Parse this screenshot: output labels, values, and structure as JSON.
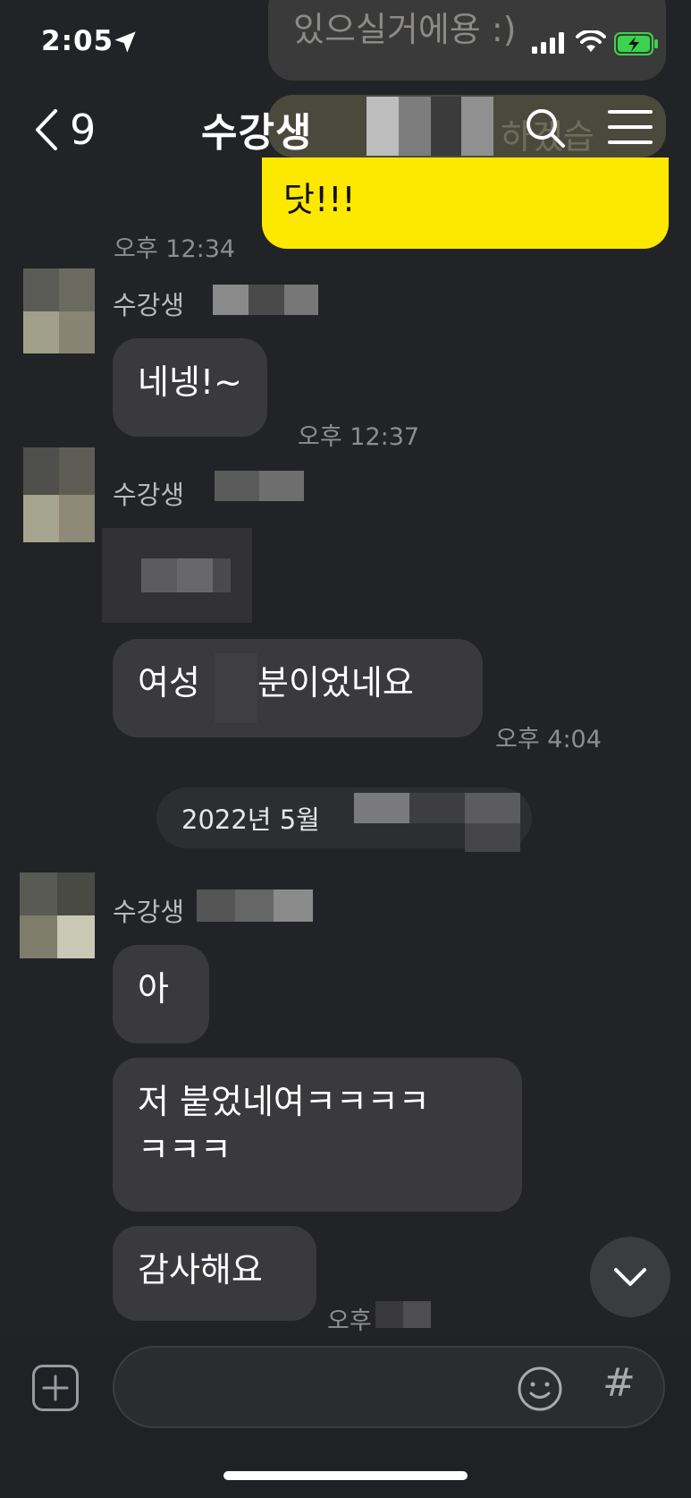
{
  "status_bar": {
    "time": "2:05"
  },
  "header": {
    "back_count": "9",
    "title": "수강생"
  },
  "messages": {
    "top_partial_text": "있으실거에용 :)",
    "top_partial_text2": "하겠습",
    "mine_text": "닷!!!",
    "mine_time": "오후 12:34",
    "sender1": "수강생",
    "msg1": "네넹!~",
    "time1": "오후 12:37",
    "sender2": "수강생",
    "msg2_visible_left": "여성",
    "msg2_visible_right": "분이었네요",
    "time2": "오후 4:04",
    "date_chip": "2022년 5월",
    "sender3": "수강생",
    "msg3": "아",
    "msg4_line1": "저 붙었네여ㅋㅋㅋㅋ",
    "msg4_line2": "ㅋㅋㅋ",
    "msg5": "감사해요",
    "time5": "오후"
  },
  "input": {
    "placeholder": "",
    "hash_label": "#"
  },
  "icons": {
    "back": "chevron-left-icon",
    "search": "search-icon",
    "menu": "hamburger-menu-icon",
    "scroll_down": "chevron-down-icon",
    "add": "plus-box-icon",
    "emoji": "emoji-icon",
    "location": "location-arrow-icon",
    "signal": "signal-bars-icon",
    "wifi": "wifi-icon",
    "battery": "battery-charging-icon"
  },
  "colors": {
    "background": "#222326",
    "bubble_other": "#3a3a3d",
    "bubble_mine": "#fde800",
    "battery": "#3cd34c"
  }
}
